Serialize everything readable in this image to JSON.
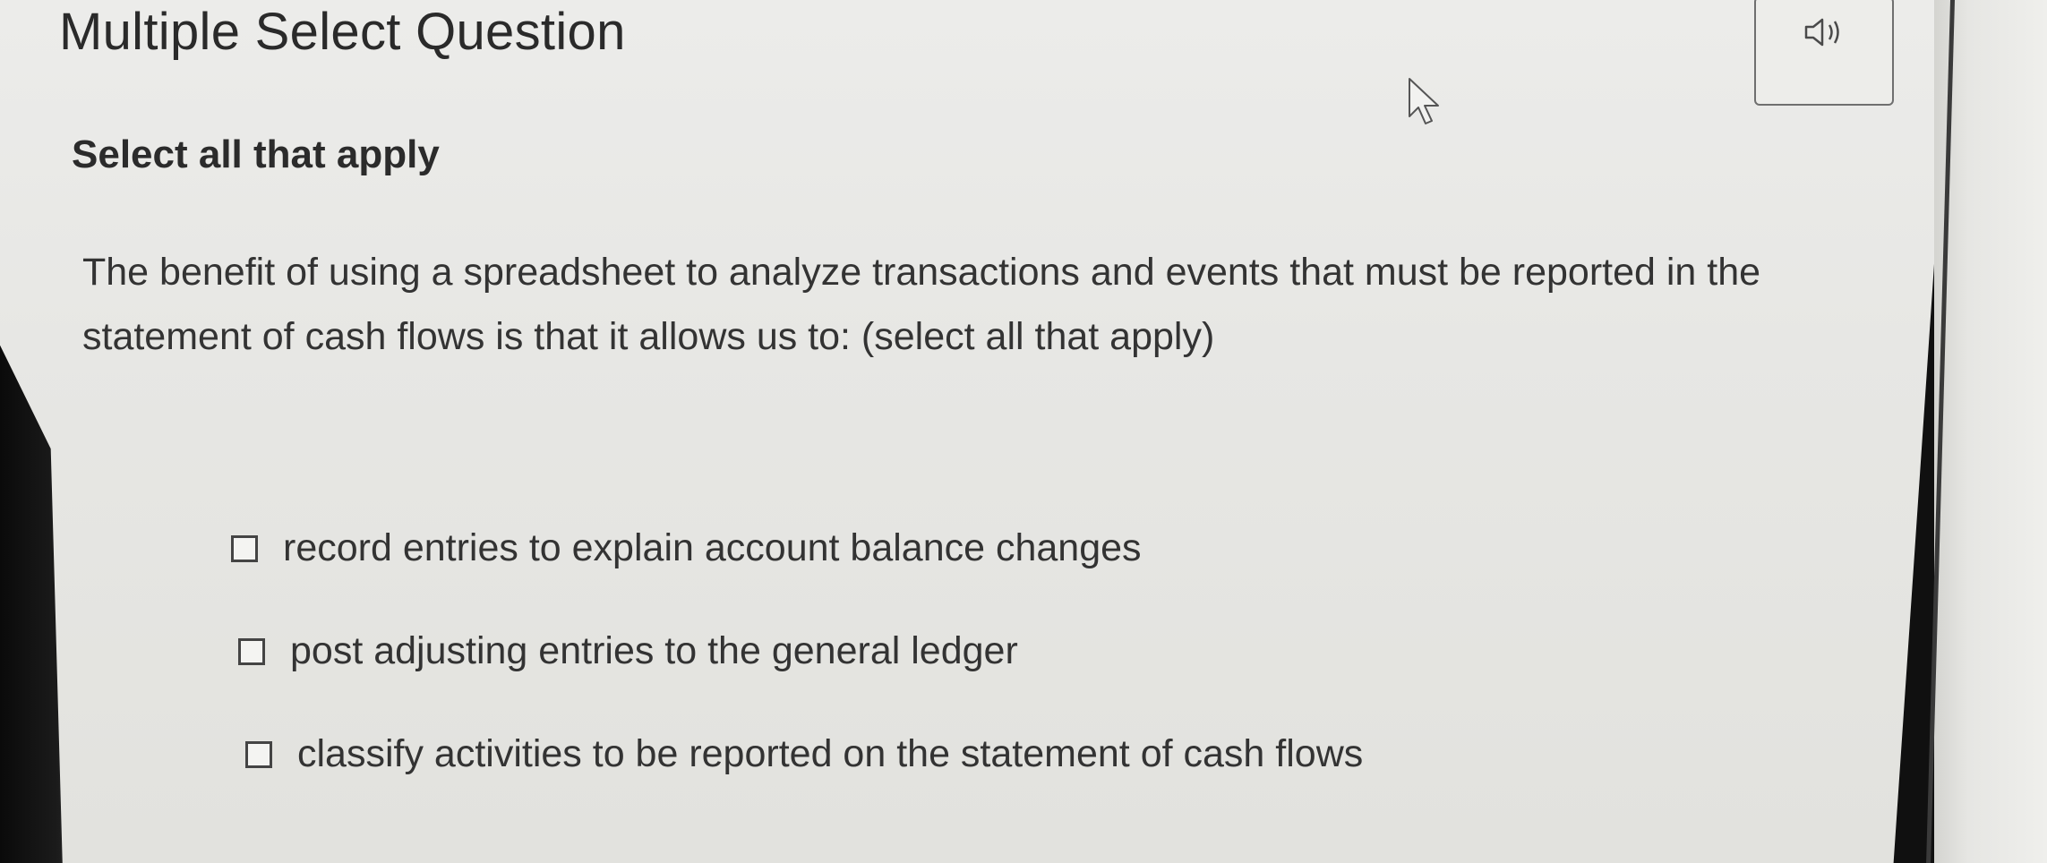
{
  "header": {
    "title": "Multiple Select Question",
    "audio_icon": "speaker-icon"
  },
  "instruction": "Select all that apply",
  "question": {
    "text": "The benefit of using a spreadsheet to analyze transactions and events that must be reported in the statement of cash flows is that it allows us to: (select all that apply)"
  },
  "options": [
    {
      "label": "record entries to explain account balance changes",
      "checked": false
    },
    {
      "label": "post adjusting entries to the general ledger",
      "checked": false
    },
    {
      "label": "classify activities to be reported on the statement of cash flows",
      "checked": false
    }
  ],
  "cursor_icon": "mouse-pointer-icon"
}
